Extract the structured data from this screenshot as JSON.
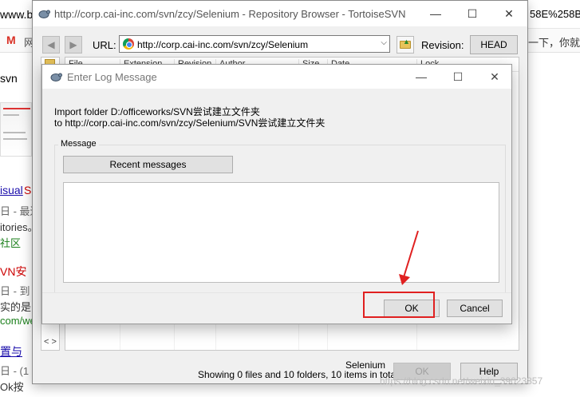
{
  "background": {
    "url_partial": "www.b",
    "url_right": "58E%258B",
    "tab_prefix": "M",
    "tab_char": "网",
    "right_text": "一下，你就知",
    "snippets": [
      "svn",
      "isual",
      "S",
      "日 - 最近",
      "itories。",
      "社区",
      "VN安",
      "日 - 到",
      "实的是",
      "com/we",
      "日 - (1",
      "Ok按",
      "置与"
    ]
  },
  "repo_browser": {
    "title": "http://corp.cai-inc.com/svn/zcy/Selenium - Repository Browser - TortoiseSVN",
    "url_label": "URL:",
    "url_value": "http://corp.cai-inc.com/svn/zcy/Selenium",
    "revision_label": "Revision:",
    "revision_button": "HEAD",
    "columns": [
      "File",
      "Extension",
      "Revision",
      "Author",
      "Size",
      "Date",
      "Lock"
    ],
    "status_path": "Selenium",
    "status_count": "Showing 0 files and 10 folders, 10 items in total",
    "ok_label": "OK",
    "help_label": "Help",
    "scroll_arrows": "<  >"
  },
  "log_dialog": {
    "title": "Enter Log Message",
    "import_line1": "Import folder D:/officeworks/SVN尝试建立文件夹",
    "import_line2": "to http://corp.cai-inc.com/svn/zcy/Selenium/SVN尝试建立文件夹",
    "group_label": "Message",
    "recent_button": "Recent messages",
    "message_value": "",
    "ok_label": "OK",
    "cancel_label": "Cancel"
  },
  "window_controls": {
    "minimize": "—",
    "maximize": "☐",
    "close": "✕"
  },
  "icons": [
    "tortoisesvn-icon",
    "chrome-icon",
    "folder-up-icon",
    "back-arrow-icon",
    "forward-arrow-icon",
    "red-arrow-icon"
  ],
  "annotation": {
    "color": "#e02020"
  },
  "watermark": "https://blog.csdn.net/weixin_39023857"
}
